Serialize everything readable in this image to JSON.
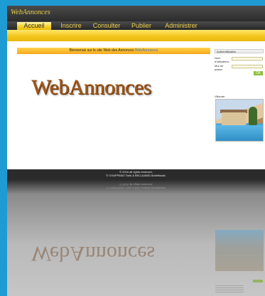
{
  "header": {
    "brand": "WebAnnonces"
  },
  "nav": {
    "items": [
      {
        "label": "Accueil",
        "active": true
      },
      {
        "label": "Inscrire",
        "active": false
      },
      {
        "label": "Consulter",
        "active": false
      },
      {
        "label": "Publier",
        "active": false
      },
      {
        "label": "Administrer",
        "active": false
      }
    ]
  },
  "main": {
    "welcome": "Bienvenue sur le site Web des Annonces",
    "welcome_link": "WebAnnonces",
    "logo_text": "WebAnnonces"
  },
  "sidebar": {
    "auth_title": "Authentification",
    "username_label": "Nom d'utilisateur:",
    "password_label": "Mot de passe:",
    "ok_label": "OK",
    "featured_title": "Villaorte"
  },
  "footer": {
    "line1": "© 2016 all rights reserved,",
    "line2": "© CHAPPANO Tarik & BELLAABID Abdelbaaki."
  },
  "colors": {
    "accent_yellow": "#f2c31a",
    "brand_text": "#e8cf4a",
    "ok_green": "#8bbf3a",
    "page_border": "#1f9bd3"
  }
}
